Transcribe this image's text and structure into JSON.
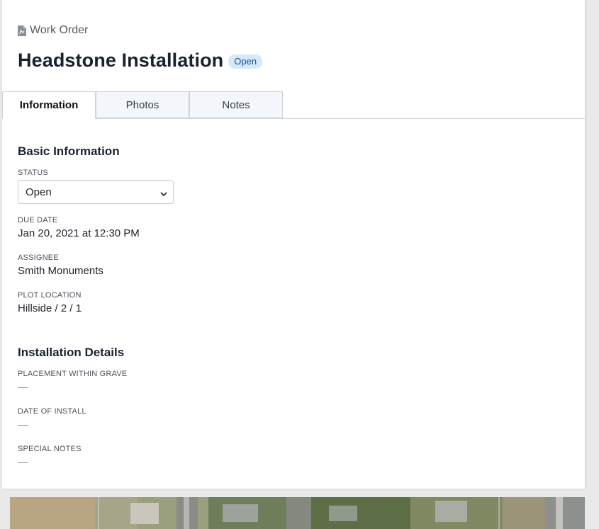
{
  "header": {
    "kicker": "Work Order",
    "title": "Headstone Installation",
    "status_badge": "Open"
  },
  "tabs": [
    {
      "label": "Information",
      "active": true
    },
    {
      "label": "Photos",
      "active": false
    },
    {
      "label": "Notes",
      "active": false
    }
  ],
  "basic_info": {
    "section_title": "Basic Information",
    "status_label": "STATUS",
    "status_value": "Open",
    "due_date_label": "DUE DATE",
    "due_date_value": "Jan 20, 2021 at 12:30 PM",
    "assignee_label": "ASSIGNEE",
    "assignee_value": "Smith Monuments",
    "plot_location_label": "PLOT LOCATION",
    "plot_location_value": "Hillside / 2 / 1"
  },
  "installation_details": {
    "section_title": "Installation Details",
    "placement_label": "PLACEMENT WITHIN GRAVE",
    "date_of_install_label": "DATE OF INSTALL",
    "special_notes_label": "SPECIAL NOTES"
  },
  "colors": {
    "badge_bg": "#d6e8fb",
    "badge_text": "#1d4e89",
    "active_tab_bg": "#ffffff",
    "inactive_tab_bg": "#f3f6fa"
  }
}
